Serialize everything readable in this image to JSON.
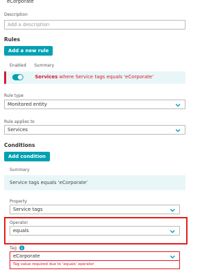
{
  "name_value": "eCorporate",
  "description": {
    "label": "Description",
    "placeholder": "Add a description"
  },
  "rules": {
    "heading": "Rules",
    "add_button": "Add a new rule",
    "col_enabled": "Enabled",
    "col_summary": "Summary",
    "rule": {
      "entity": "Services",
      "text": " where Service tags equals 'eCorporate'"
    }
  },
  "rule_type": {
    "label": "Rule type",
    "value": "Monitored entity"
  },
  "rule_applies": {
    "label": "Rule applies to",
    "value": "Services"
  },
  "conditions": {
    "heading": "Conditions",
    "add_button": "Add condition",
    "summary_label": "Summary",
    "summary_text": "Service tags equals 'eCorporate'"
  },
  "property": {
    "label": "Property",
    "value": "Service tags"
  },
  "operator": {
    "label": "Operator",
    "value": "equals"
  },
  "tag": {
    "label": "Tag",
    "value": "eCorporate",
    "error": "Tag value required due to 'equals' operator"
  },
  "colors": {
    "accent": "#00a1b2",
    "error": "#dc172a",
    "highlight": "#e41b1b"
  },
  "icons": {
    "dropdown": "chevron-down-icon",
    "info": "info-icon"
  }
}
